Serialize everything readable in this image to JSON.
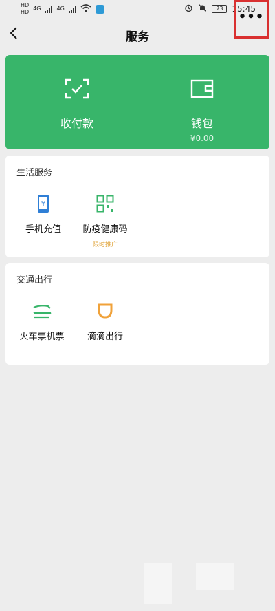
{
  "status_bar": {
    "sim1": "HD",
    "sim2": "HD",
    "net1": "4G",
    "net2": "4G",
    "battery": "73",
    "time": "15:45"
  },
  "header": {
    "title": "服务",
    "back_icon": "chevron-left-icon",
    "more_icon": "more-dots-icon"
  },
  "wallet_card": {
    "bg_color": "#38b56a",
    "items": [
      {
        "label": "收付款",
        "icon": "scan-pay-icon"
      },
      {
        "label": "钱包",
        "sub": "¥0.00",
        "icon": "wallet-icon"
      }
    ]
  },
  "life_services": {
    "title": "生活服务",
    "items": [
      {
        "label": "手机充值",
        "icon": "phone-recharge-icon"
      },
      {
        "label": "防疫健康码",
        "tag": "限时推广",
        "icon": "qr-code-icon"
      }
    ]
  },
  "transport": {
    "title": "交通出行",
    "items": [
      {
        "label": "火车票机票",
        "icon": "train-icon"
      },
      {
        "label": "滴滴出行",
        "icon": "didi-icon"
      }
    ]
  }
}
